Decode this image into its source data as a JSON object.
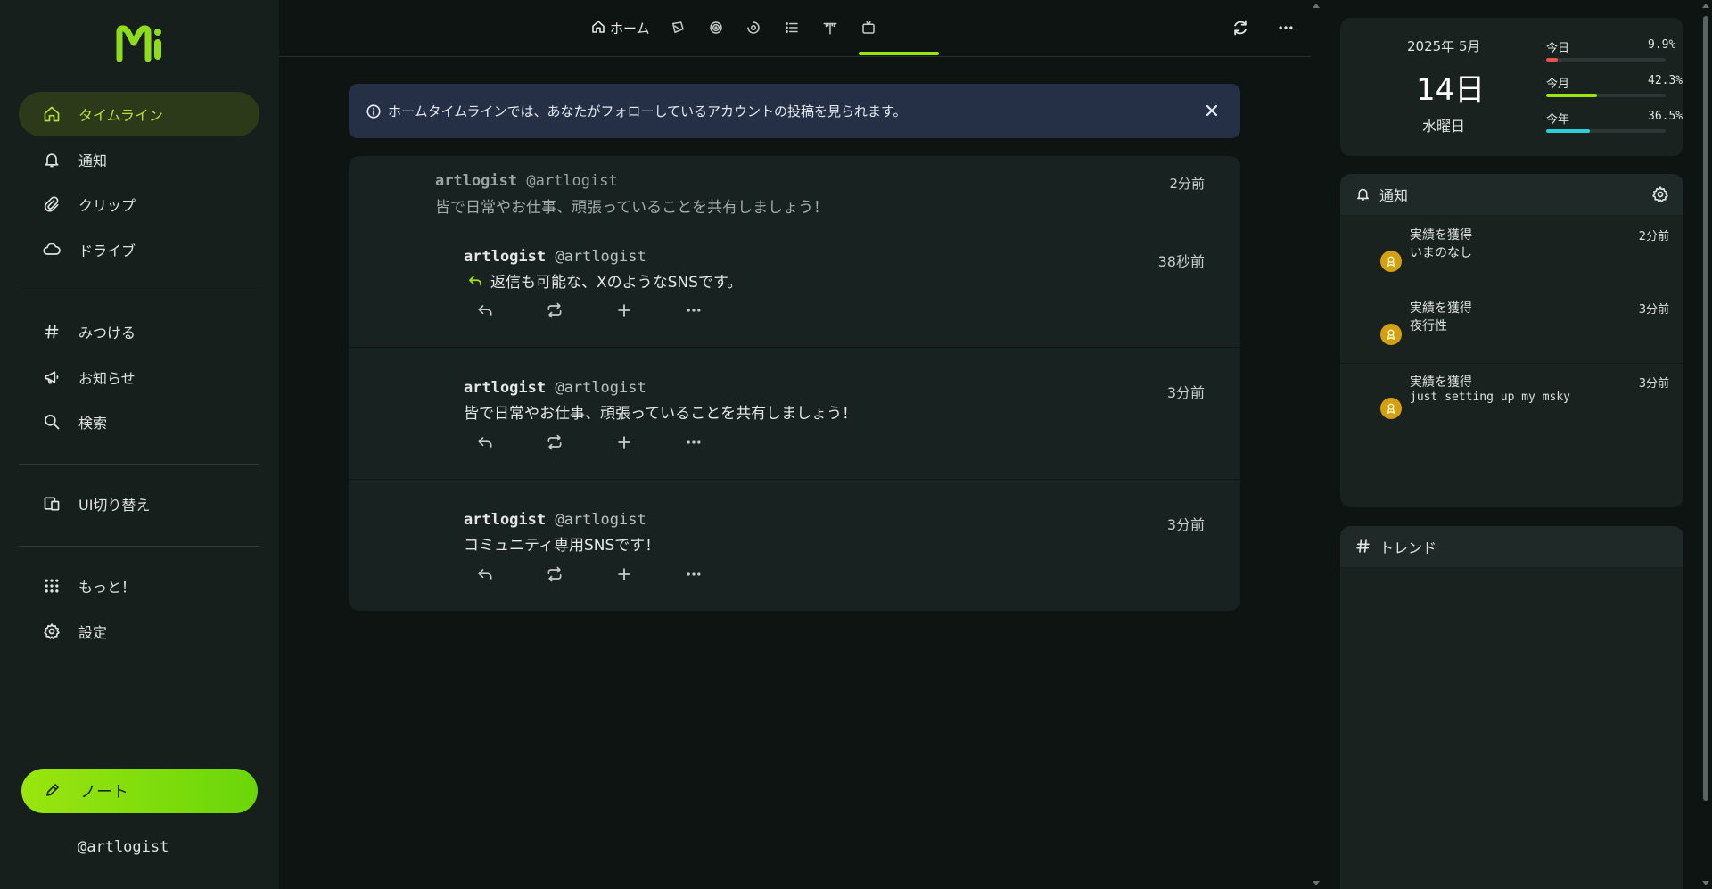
{
  "colors": {
    "accent": "#9ae50f",
    "badge": "#d4a013",
    "bar_today": "#e5534b",
    "bar_month": "#9ae50f",
    "bar_year": "#2bd0d8"
  },
  "sidebar": {
    "logo": "Mi",
    "items": [
      {
        "label": "タイムライン",
        "icon": "home-icon",
        "active": true
      },
      {
        "label": "通知",
        "icon": "bell-icon"
      },
      {
        "label": "クリップ",
        "icon": "paperclip-icon"
      },
      {
        "label": "ドライブ",
        "icon": "cloud-icon"
      },
      {
        "label": "みつける",
        "icon": "hashtag-icon"
      },
      {
        "label": "お知らせ",
        "icon": "megaphone-icon"
      },
      {
        "label": "検索",
        "icon": "search-icon"
      },
      {
        "label": "UI切り替え",
        "icon": "devices-icon"
      },
      {
        "label": "もっと！",
        "icon": "grid-dots-icon"
      },
      {
        "label": "設定",
        "icon": "gear-icon"
      }
    ],
    "note_button": "ノート",
    "account": "@artlogist"
  },
  "header": {
    "tabs": [
      {
        "label": "ホーム",
        "icon": "home-icon",
        "active": true
      },
      {
        "label": "",
        "icon": "planet-icon"
      },
      {
        "label": "",
        "icon": "spiral-icon"
      },
      {
        "label": "",
        "icon": "rocket-icon"
      },
      {
        "label": "",
        "icon": "list-icon"
      },
      {
        "label": "",
        "icon": "antenna-icon"
      },
      {
        "label": "",
        "icon": "tv-icon"
      }
    ],
    "reload_icon": "refresh-icon",
    "more_icon": "more-dots-icon"
  },
  "banner": {
    "text": "ホームタイムラインでは、あなたがフォローしているアカウントの投稿を見られます。",
    "icon": "info-icon"
  },
  "timeline": {
    "notes": [
      {
        "quoted": {
          "name": "artlogist",
          "user": "@artlogist",
          "text": "皆で日常やお仕事、頑張っていることを共有しましょう！",
          "time": "2分前"
        },
        "name": "artlogist",
        "user": "@artlogist",
        "text": "返信も可能な、XのようなSNSです。",
        "time": "38秒前"
      },
      {
        "name": "artlogist",
        "user": "@artlogist",
        "text": "皆で日常やお仕事、頑張っていることを共有しましょう！",
        "time": "3分前"
      },
      {
        "name": "artlogist",
        "user": "@artlogist",
        "text": "コミュニティ専用SNSです！",
        "time": "3分前"
      }
    ]
  },
  "calendar": {
    "year_month": "2025年 5月",
    "day": "14日",
    "weekday": "水曜日",
    "stats": [
      {
        "label": "今日",
        "value": "9.9%",
        "fraction": 0.099
      },
      {
        "label": "今月",
        "value": "42.3%",
        "fraction": 0.423
      },
      {
        "label": "今年",
        "value": "36.5%",
        "fraction": 0.365
      }
    ]
  },
  "notifications": {
    "title": "通知",
    "items": [
      {
        "title": "実績を獲得",
        "body": "いまのなし",
        "time": "2分前"
      },
      {
        "title": "実績を獲得",
        "body": "夜行性",
        "time": "3分前"
      },
      {
        "title": "実績を獲得",
        "body": "just setting up my msky",
        "time": "3分前"
      }
    ]
  },
  "trends": {
    "title": "トレンド"
  }
}
